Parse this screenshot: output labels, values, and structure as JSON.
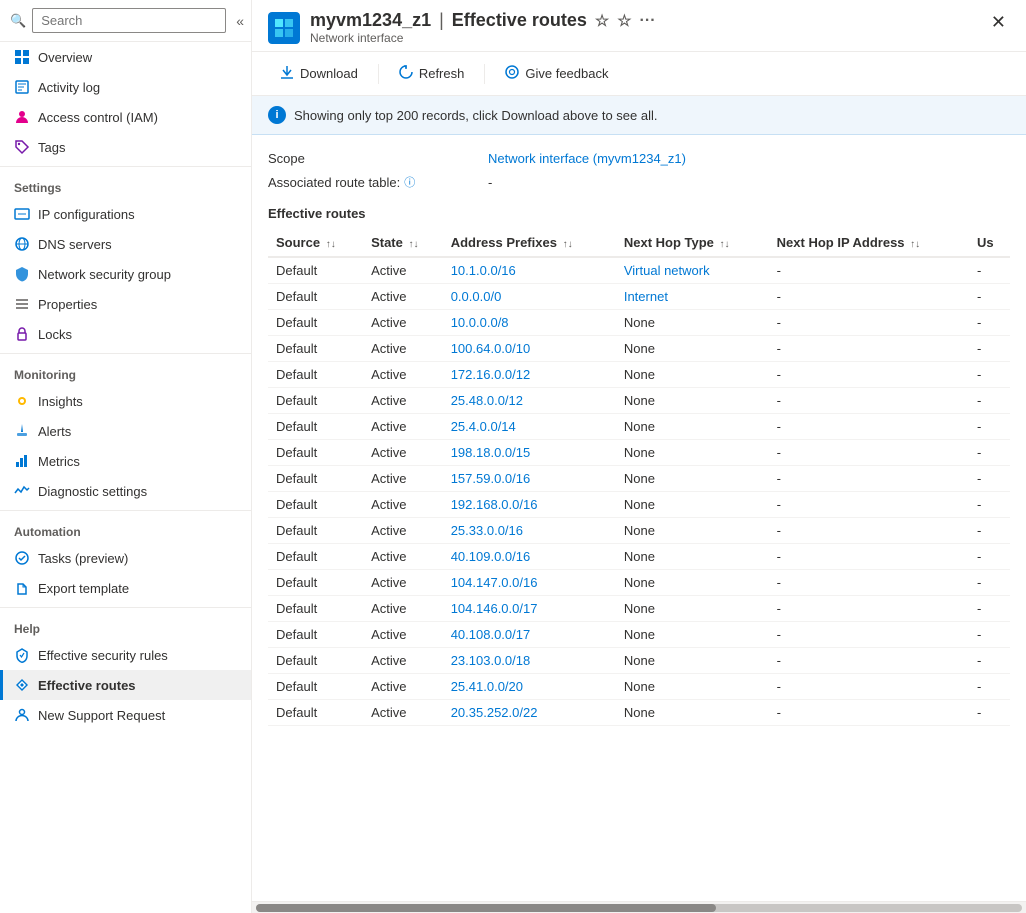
{
  "app": {
    "logo_text": "◈",
    "resource_name": "myvm1234_z1",
    "separator": "|",
    "page_title": "Effective routes",
    "subtitle": "Network interface",
    "star_icon": "☆",
    "star_filled": "★",
    "ellipsis": "···",
    "close": "✕"
  },
  "toolbar": {
    "download_label": "Download",
    "refresh_label": "Refresh",
    "feedback_label": "Give feedback"
  },
  "search": {
    "placeholder": "Search"
  },
  "info_banner": {
    "text": "Showing only top 200 records, click Download above to see all."
  },
  "meta": {
    "scope_label": "Scope",
    "scope_value": "Network interface (myvm1234_z1)",
    "route_table_label": "Associated route table:",
    "route_table_value": "-"
  },
  "table": {
    "title": "Effective routes",
    "columns": [
      "Source",
      "State",
      "Address Prefixes",
      "Next Hop Type",
      "Next Hop IP Address",
      "Us"
    ],
    "rows": [
      {
        "source": "Default",
        "state": "Active",
        "address": "10.1.0.0/16",
        "hop_type": "Virtual network",
        "hop_ip": "-",
        "us": "-"
      },
      {
        "source": "Default",
        "state": "Active",
        "address": "0.0.0.0/0",
        "hop_type": "Internet",
        "hop_ip": "-",
        "us": "-"
      },
      {
        "source": "Default",
        "state": "Active",
        "address": "10.0.0.0/8",
        "hop_type": "None",
        "hop_ip": "-",
        "us": "-"
      },
      {
        "source": "Default",
        "state": "Active",
        "address": "100.64.0.0/10",
        "hop_type": "None",
        "hop_ip": "-",
        "us": "-"
      },
      {
        "source": "Default",
        "state": "Active",
        "address": "172.16.0.0/12",
        "hop_type": "None",
        "hop_ip": "-",
        "us": "-"
      },
      {
        "source": "Default",
        "state": "Active",
        "address": "25.48.0.0/12",
        "hop_type": "None",
        "hop_ip": "-",
        "us": "-"
      },
      {
        "source": "Default",
        "state": "Active",
        "address": "25.4.0.0/14",
        "hop_type": "None",
        "hop_ip": "-",
        "us": "-"
      },
      {
        "source": "Default",
        "state": "Active",
        "address": "198.18.0.0/15",
        "hop_type": "None",
        "hop_ip": "-",
        "us": "-"
      },
      {
        "source": "Default",
        "state": "Active",
        "address": "157.59.0.0/16",
        "hop_type": "None",
        "hop_ip": "-",
        "us": "-"
      },
      {
        "source": "Default",
        "state": "Active",
        "address": "192.168.0.0/16",
        "hop_type": "None",
        "hop_ip": "-",
        "us": "-"
      },
      {
        "source": "Default",
        "state": "Active",
        "address": "25.33.0.0/16",
        "hop_type": "None",
        "hop_ip": "-",
        "us": "-"
      },
      {
        "source": "Default",
        "state": "Active",
        "address": "40.109.0.0/16",
        "hop_type": "None",
        "hop_ip": "-",
        "us": "-"
      },
      {
        "source": "Default",
        "state": "Active",
        "address": "104.147.0.0/16",
        "hop_type": "None",
        "hop_ip": "-",
        "us": "-"
      },
      {
        "source": "Default",
        "state": "Active",
        "address": "104.146.0.0/17",
        "hop_type": "None",
        "hop_ip": "-",
        "us": "-"
      },
      {
        "source": "Default",
        "state": "Active",
        "address": "40.108.0.0/17",
        "hop_type": "None",
        "hop_ip": "-",
        "us": "-"
      },
      {
        "source": "Default",
        "state": "Active",
        "address": "23.103.0.0/18",
        "hop_type": "None",
        "hop_ip": "-",
        "us": "-"
      },
      {
        "source": "Default",
        "state": "Active",
        "address": "25.41.0.0/20",
        "hop_type": "None",
        "hop_ip": "-",
        "us": "-"
      },
      {
        "source": "Default",
        "state": "Active",
        "address": "20.35.252.0/22",
        "hop_type": "None",
        "hop_ip": "-",
        "us": "-"
      }
    ]
  },
  "sidebar": {
    "collapse_icon": "«",
    "sections": [
      {
        "items": [
          {
            "id": "overview",
            "label": "Overview",
            "icon": "⊞",
            "color": "#0078d4"
          },
          {
            "id": "activity-log",
            "label": "Activity log",
            "icon": "📋",
            "color": "#0078d4"
          },
          {
            "id": "iam",
            "label": "Access control (IAM)",
            "icon": "👤",
            "color": "#e3008c"
          },
          {
            "id": "tags",
            "label": "Tags",
            "icon": "🏷",
            "color": "#7719aa"
          }
        ]
      },
      {
        "title": "Settings",
        "items": [
          {
            "id": "ip-config",
            "label": "IP configurations",
            "icon": "⚙",
            "color": "#0078d4"
          },
          {
            "id": "dns",
            "label": "DNS servers",
            "icon": "🌐",
            "color": "#0078d4"
          },
          {
            "id": "nsg",
            "label": "Network security group",
            "icon": "🛡",
            "color": "#0078d4"
          },
          {
            "id": "properties",
            "label": "Properties",
            "icon": "≡",
            "color": "#605e5c"
          },
          {
            "id": "locks",
            "label": "Locks",
            "icon": "🔒",
            "color": "#7719aa"
          }
        ]
      },
      {
        "title": "Monitoring",
        "items": [
          {
            "id": "insights",
            "label": "Insights",
            "icon": "💡",
            "color": "#ffb900"
          },
          {
            "id": "alerts",
            "label": "Alerts",
            "icon": "🔔",
            "color": "#0078d4"
          },
          {
            "id": "metrics",
            "label": "Metrics",
            "icon": "📊",
            "color": "#0078d4"
          },
          {
            "id": "diagnostic",
            "label": "Diagnostic settings",
            "icon": "📈",
            "color": "#0078d4"
          }
        ]
      },
      {
        "title": "Automation",
        "items": [
          {
            "id": "tasks",
            "label": "Tasks (preview)",
            "icon": "⚙",
            "color": "#0078d4"
          },
          {
            "id": "export",
            "label": "Export template",
            "icon": "↗",
            "color": "#0078d4"
          }
        ]
      },
      {
        "title": "Help",
        "items": [
          {
            "id": "sec-rules",
            "label": "Effective security rules",
            "icon": "↓",
            "color": "#0078d4"
          },
          {
            "id": "eff-routes",
            "label": "Effective routes",
            "icon": "◆",
            "color": "#0078d4",
            "active": true
          },
          {
            "id": "support",
            "label": "New Support Request",
            "icon": "👤",
            "color": "#0078d4"
          }
        ]
      }
    ]
  }
}
